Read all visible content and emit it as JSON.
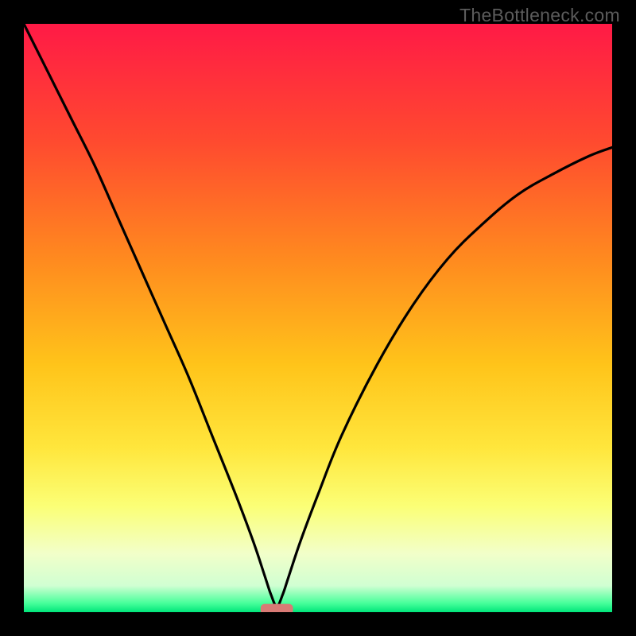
{
  "watermark": "TheBottleneck.com",
  "chart_data": {
    "type": "line",
    "title": "",
    "xlabel": "",
    "ylabel": "",
    "xlim": [
      0,
      100
    ],
    "ylim": [
      0,
      100
    ],
    "grid": false,
    "legend": false,
    "background_gradient": {
      "stops": [
        {
          "offset": 0.0,
          "color": "#ff1a46"
        },
        {
          "offset": 0.2,
          "color": "#ff4a2f"
        },
        {
          "offset": 0.4,
          "color": "#ff8a1f"
        },
        {
          "offset": 0.58,
          "color": "#ffc41a"
        },
        {
          "offset": 0.72,
          "color": "#ffe63c"
        },
        {
          "offset": 0.82,
          "color": "#fbff76"
        },
        {
          "offset": 0.9,
          "color": "#f2ffc9"
        },
        {
          "offset": 0.955,
          "color": "#d0ffd2"
        },
        {
          "offset": 0.985,
          "color": "#46ff9a"
        },
        {
          "offset": 1.0,
          "color": "#00e57a"
        }
      ]
    },
    "series": [
      {
        "name": "bottleneck-curve",
        "description": "V-shaped curve; left limb from top-left falling to minimum near x≈43, right limb rising toward upper-right",
        "x": [
          0,
          4,
          8,
          12,
          16,
          20,
          24,
          28,
          32,
          36,
          39,
          41,
          42,
          43,
          44,
          45,
          47,
          50,
          54,
          60,
          66,
          72,
          78,
          84,
          90,
          96,
          100
        ],
        "y": [
          100,
          92,
          84,
          76,
          67,
          58,
          49,
          40,
          30,
          20,
          12,
          6,
          3,
          1,
          3,
          6,
          12,
          20,
          30,
          42,
          52,
          60,
          66,
          71,
          74.5,
          77.5,
          79
        ]
      }
    ],
    "marker": {
      "name": "min-marker",
      "shape": "rounded-rect",
      "x": 43,
      "y": 0.5,
      "width_frac": 0.055,
      "height_frac": 0.018,
      "color": "#d97a75"
    }
  }
}
